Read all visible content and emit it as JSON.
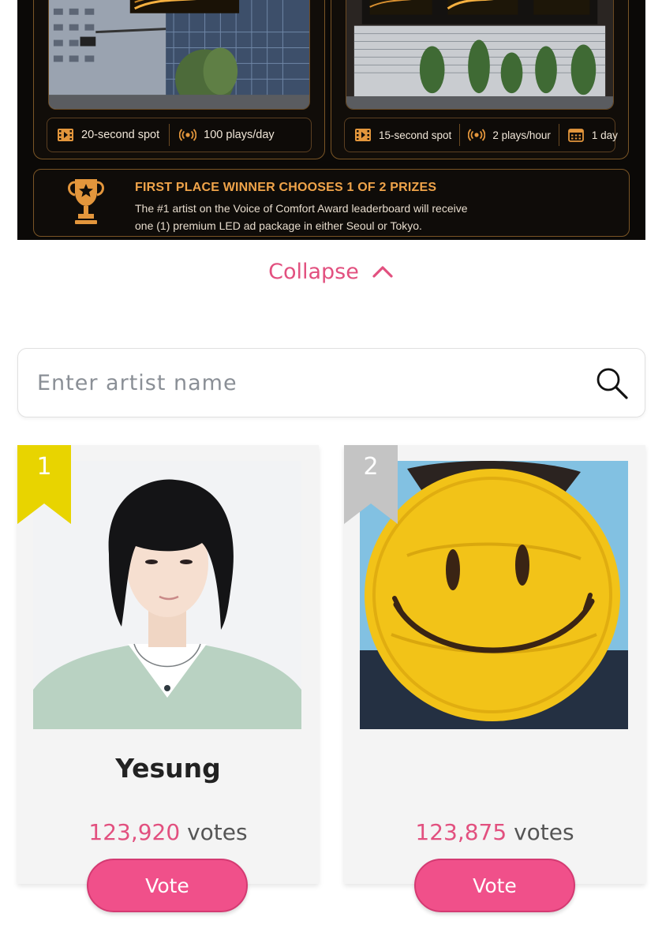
{
  "banner": {
    "left_panel": {
      "specs": [
        {
          "icon": "film-icon",
          "text": "20-second spot"
        },
        {
          "icon": "broadcast-icon",
          "text": "100 plays/day"
        }
      ]
    },
    "right_panel": {
      "billboard_texts": [
        "starvibe",
        "starvibe"
      ],
      "specs": [
        {
          "icon": "film-icon",
          "text": "15-second spot"
        },
        {
          "icon": "broadcast-icon",
          "text": "2 plays/hour"
        },
        {
          "icon": "calendar-icon",
          "text": "1 day"
        }
      ]
    },
    "prize": {
      "icon": "trophy-icon",
      "title": "FIRST PLACE WINNER CHOOSES 1 OF 2 PRIZES",
      "line1": "The #1 artist on the Voice of Comfort Award leaderboard will receive",
      "line2": "one (1) premium LED ad package in either Seoul or Tokyo."
    },
    "accent_color": "#e3963c"
  },
  "collapse": {
    "label": "Collapse",
    "icon": "chevron-up-icon"
  },
  "search": {
    "placeholder": "Enter artist name",
    "value": "",
    "icon": "search-icon"
  },
  "cards": [
    {
      "rank": "1",
      "rank_color": "#e8d400",
      "name": "Yesung",
      "votes_count": "123,920",
      "votes_label": " votes",
      "button": "Vote"
    },
    {
      "rank": "2",
      "rank_color": "#c4c4c4",
      "name": "",
      "votes_count": "123,875",
      "votes_label": " votes",
      "button": "Vote"
    }
  ],
  "colors": {
    "brand_pink": "#e2507f",
    "button_pink": "#f0508a"
  }
}
